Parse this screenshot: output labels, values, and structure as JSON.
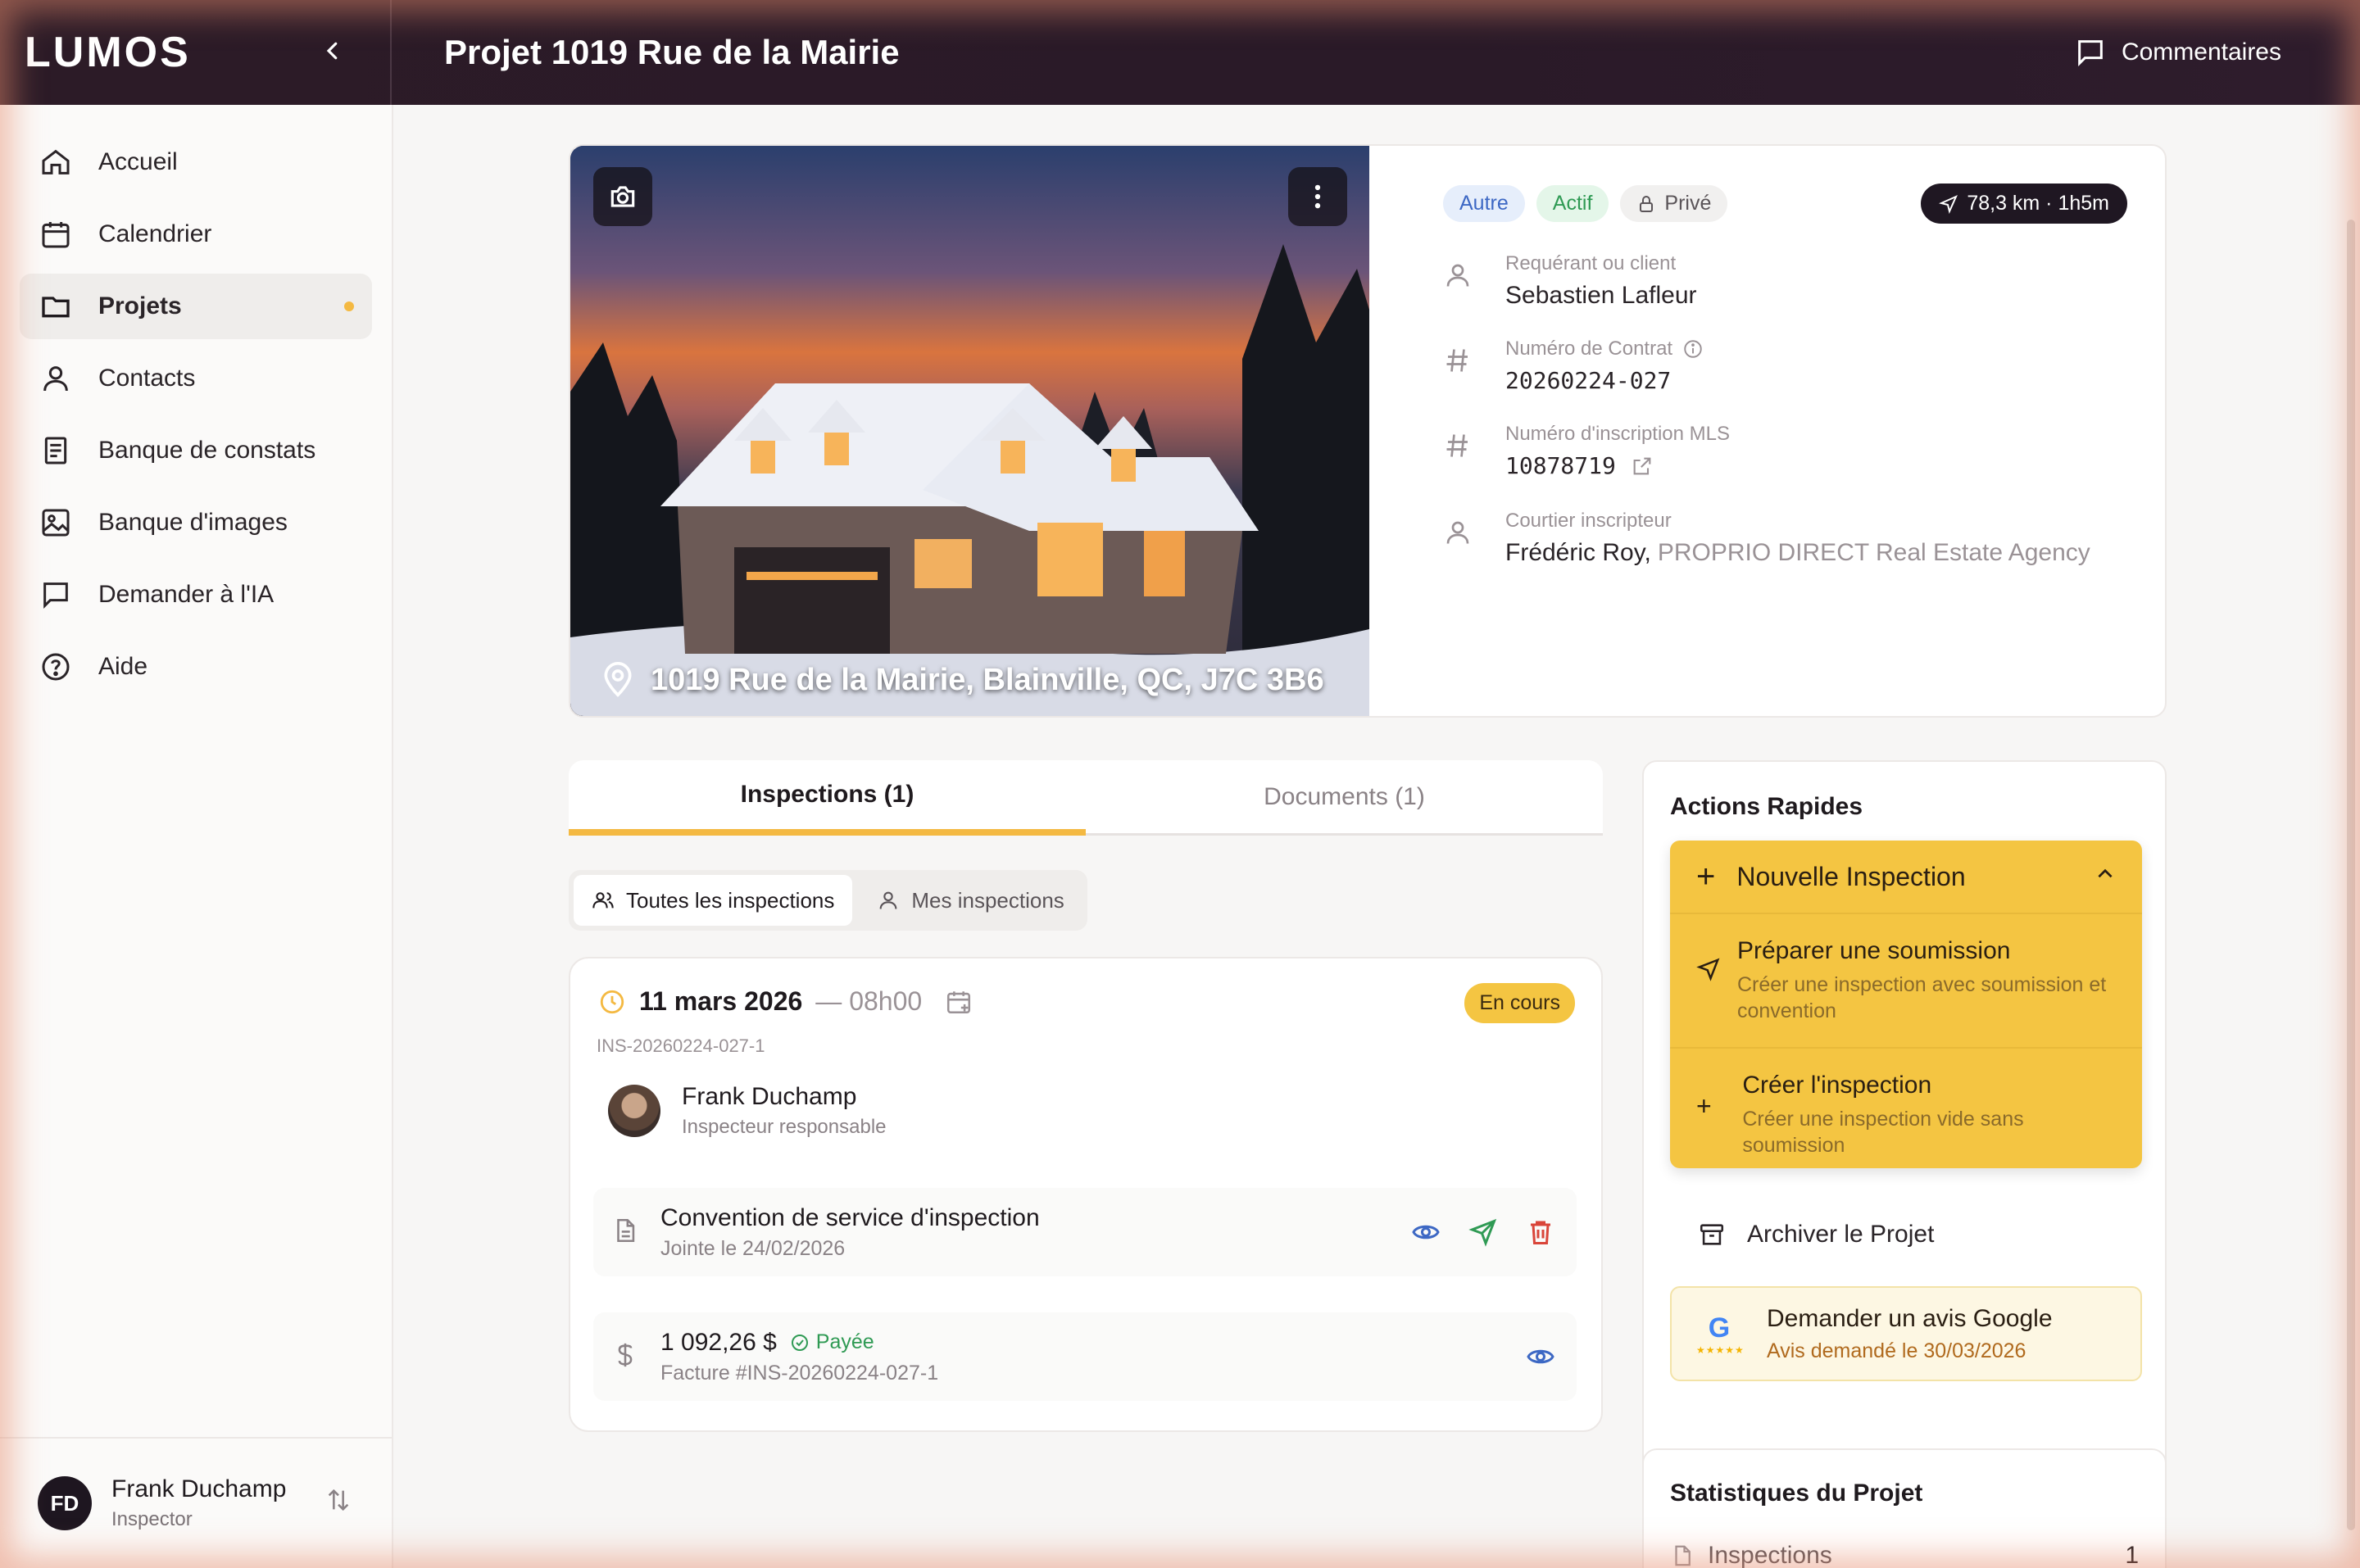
{
  "app": {
    "logo": "LUMOS",
    "page_title": "Projet 1019 Rue de la Mairie",
    "comments_label": "Commentaires"
  },
  "sidebar": {
    "items": [
      {
        "label": "Accueil",
        "icon": "home-icon"
      },
      {
        "label": "Calendrier",
        "icon": "calendar-icon"
      },
      {
        "label": "Projets",
        "icon": "folder-icon",
        "active": true
      },
      {
        "label": "Contacts",
        "icon": "user-icon"
      },
      {
        "label": "Banque de constats",
        "icon": "notes-icon"
      },
      {
        "label": "Banque d'images",
        "icon": "image-icon"
      },
      {
        "label": "Demander à l'IA",
        "icon": "chat-icon"
      },
      {
        "label": "Aide",
        "icon": "help-icon"
      }
    ],
    "user": {
      "initials": "FD",
      "name": "Frank Duchamp",
      "role": "Inspector"
    }
  },
  "project": {
    "address": "1019 Rue de la Mairie, Blainville, QC, J7C 3B6",
    "badges": {
      "type": "Autre",
      "status": "Actif",
      "privacy": "Privé"
    },
    "distance": "78,3 km · 1h5m",
    "client_label": "Requérant ou client",
    "client": "Sebastien Lafleur",
    "contract_label": "Numéro de Contrat",
    "contract": "20260224-027",
    "mls_label": "Numéro d'inscription MLS",
    "mls": "10878719",
    "broker_label": "Courtier inscripteur",
    "broker_name": "Frédéric Roy,",
    "broker_agency": "PROPRIO DIRECT Real Estate Agency"
  },
  "tabs": {
    "inspections": "Inspections (1)",
    "documents": "Documents (1)"
  },
  "filters": {
    "all": "Toutes les inspections",
    "mine": "Mes inspections"
  },
  "inspection": {
    "date": "11 mars 2026",
    "time": "— 08h00",
    "status": "En cours",
    "id": "INS-20260224-027-1",
    "inspector_name": "Frank Duchamp",
    "inspector_role": "Inspecteur responsable",
    "doc_title": "Convention de service d'inspection",
    "doc_sub": "Jointe le 24/02/2026",
    "invoice_amount": "1 092,26 $",
    "invoice_status": "Payée",
    "invoice_sub": "Facture #INS-20260224-027-1"
  },
  "quick_actions": {
    "title": "Actions Rapides",
    "new_inspection": "Nouvelle Inspection",
    "prepare_title": "Préparer une soumission",
    "prepare_sub": "Créer une inspection avec soumission et convention",
    "create_title": "Créer l'inspection",
    "create_sub": "Créer une inspection vide sans soumission",
    "archive": "Archiver le Projet",
    "google_title": "Demander un avis Google",
    "google_sub": "Avis demandé le 30/03/2026",
    "google_letter": "G"
  },
  "stats": {
    "title": "Statistiques du Projet",
    "inspections_label": "Inspections",
    "inspections_count": "1"
  },
  "colors": {
    "accent": "#f4b942",
    "topbar": "#2a1a28",
    "paid": "#2f9a54",
    "link_blue": "#3d68c4"
  }
}
